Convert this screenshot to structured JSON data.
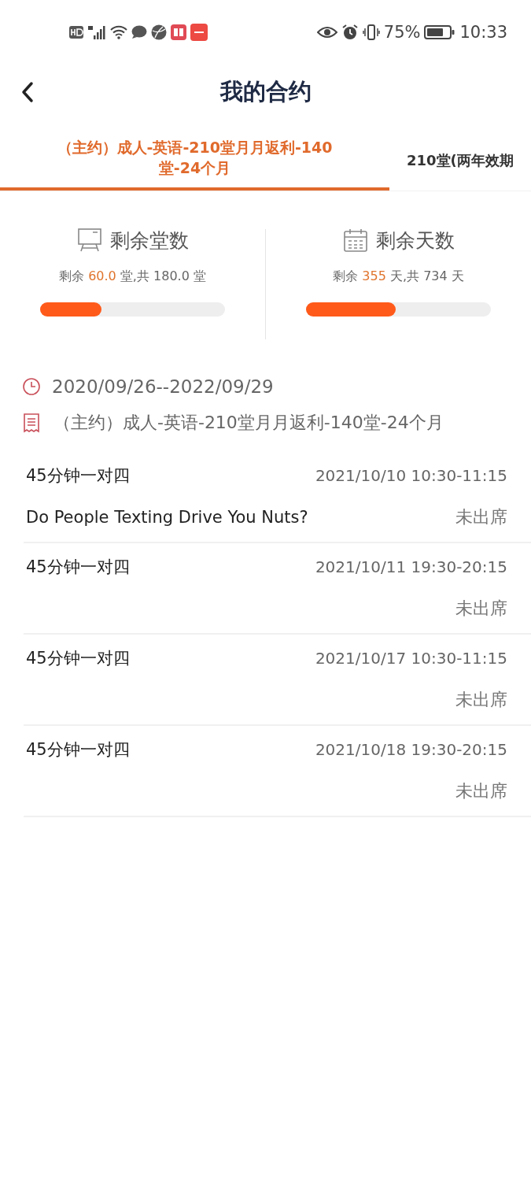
{
  "status_bar": {
    "battery": "75%",
    "time": "10:33"
  },
  "header": {
    "title": "我的合约"
  },
  "tabs": [
    {
      "label": "（主约）成人-英语-210堂月月返利-140堂-24个月",
      "selected": true
    },
    {
      "label": "210堂(两年效期",
      "selected": false
    }
  ],
  "stats": [
    {
      "kind": "lessons",
      "title": "剩余堂数",
      "prefix": "剩余",
      "value": "60.0",
      "suffix": "堂,共 180.0 堂",
      "level": 0.333
    },
    {
      "kind": "days",
      "title": "剩余天数",
      "prefix": "剩余",
      "value": "355",
      "suffix": "天,共 734 天",
      "level": 0.484
    }
  ],
  "contract": {
    "period": "2020/09/26--2022/09/29",
    "name": "（主约）成人-英语-210堂月月返利-140堂-24个月"
  },
  "sessions": [
    {
      "type": "45分钟一对四",
      "time": "2021/10/10 10:30-11:15",
      "topic": "Do People Texting Drive You Nuts?",
      "status": "未出席"
    },
    {
      "type": "45分钟一对四",
      "time": "2021/10/11 19:30-20:15",
      "status": "未出席"
    },
    {
      "type": "45分钟一对四",
      "time": "2021/10/17 10:30-11:15",
      "status": "未出席"
    },
    {
      "type": "45分钟一对四",
      "time": "2021/10/18 19:30-20:15",
      "status": "未出席"
    }
  ]
}
